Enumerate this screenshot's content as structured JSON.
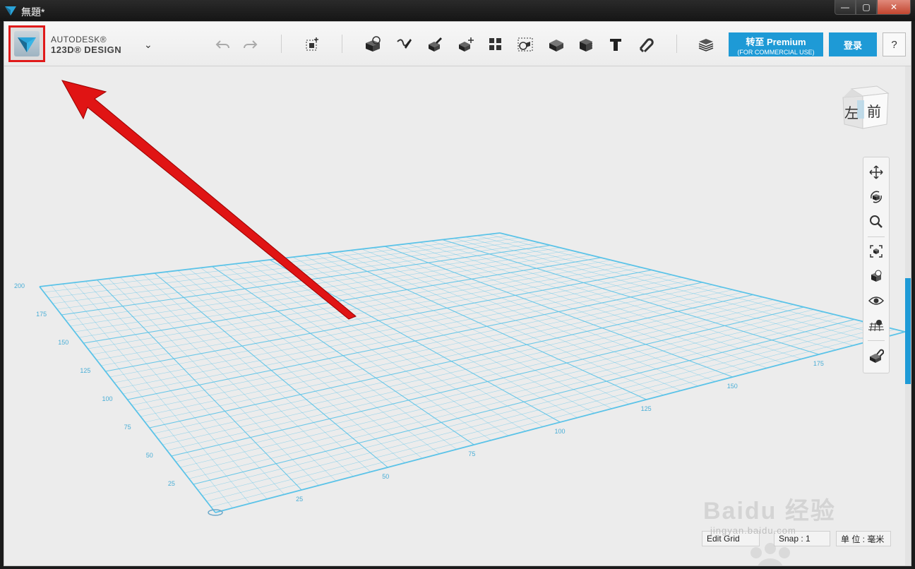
{
  "window": {
    "title": "無題*",
    "buttons": {
      "minimize": "—",
      "maximize": "▢",
      "close": "✕"
    }
  },
  "toolbar": {
    "brand_line1": "AUTODESK®",
    "brand_line2": "123D® DESIGN",
    "menu_chevron": "⌄",
    "icons": [
      "undo-icon",
      "redo-icon",
      "transform-icon",
      "primitives-icon",
      "sketch-icon",
      "construct-icon",
      "modify-icon",
      "pattern-icon",
      "grouping-icon",
      "combine-icon",
      "measure-icon",
      "text-icon",
      "snap-icon",
      "material-icon"
    ],
    "premium_label": "转至 Premium",
    "premium_sub": "(FOR COMMERCIAL USE)",
    "login_label": "登录",
    "help_label": "?"
  },
  "viewcube": {
    "left_face": "左",
    "front_face": "前"
  },
  "nav": {
    "icons": [
      "pan-icon",
      "orbit-icon",
      "zoom-icon",
      "fit-icon",
      "view-mode-icon",
      "visibility-icon",
      "grid-material-icon",
      "snap-magnet-icon"
    ]
  },
  "statusbar": {
    "edit_grid": "Edit Grid",
    "snap": "Snap : 1",
    "units": "单 位 : 毫米"
  },
  "grid": {
    "axis_labels_right": [
      "25",
      "50",
      "75",
      "100",
      "125",
      "150",
      "175"
    ],
    "axis_labels_left": [
      "25",
      "50",
      "75",
      "100",
      "125",
      "150",
      "175",
      "200"
    ]
  },
  "watermark": {
    "text": "jingyan.baidu.com",
    "logo": "Baidu 经验"
  },
  "colors": {
    "accent": "#1e9ad6",
    "grid": "#5bc3e8",
    "highlight": "#e01a1a"
  }
}
